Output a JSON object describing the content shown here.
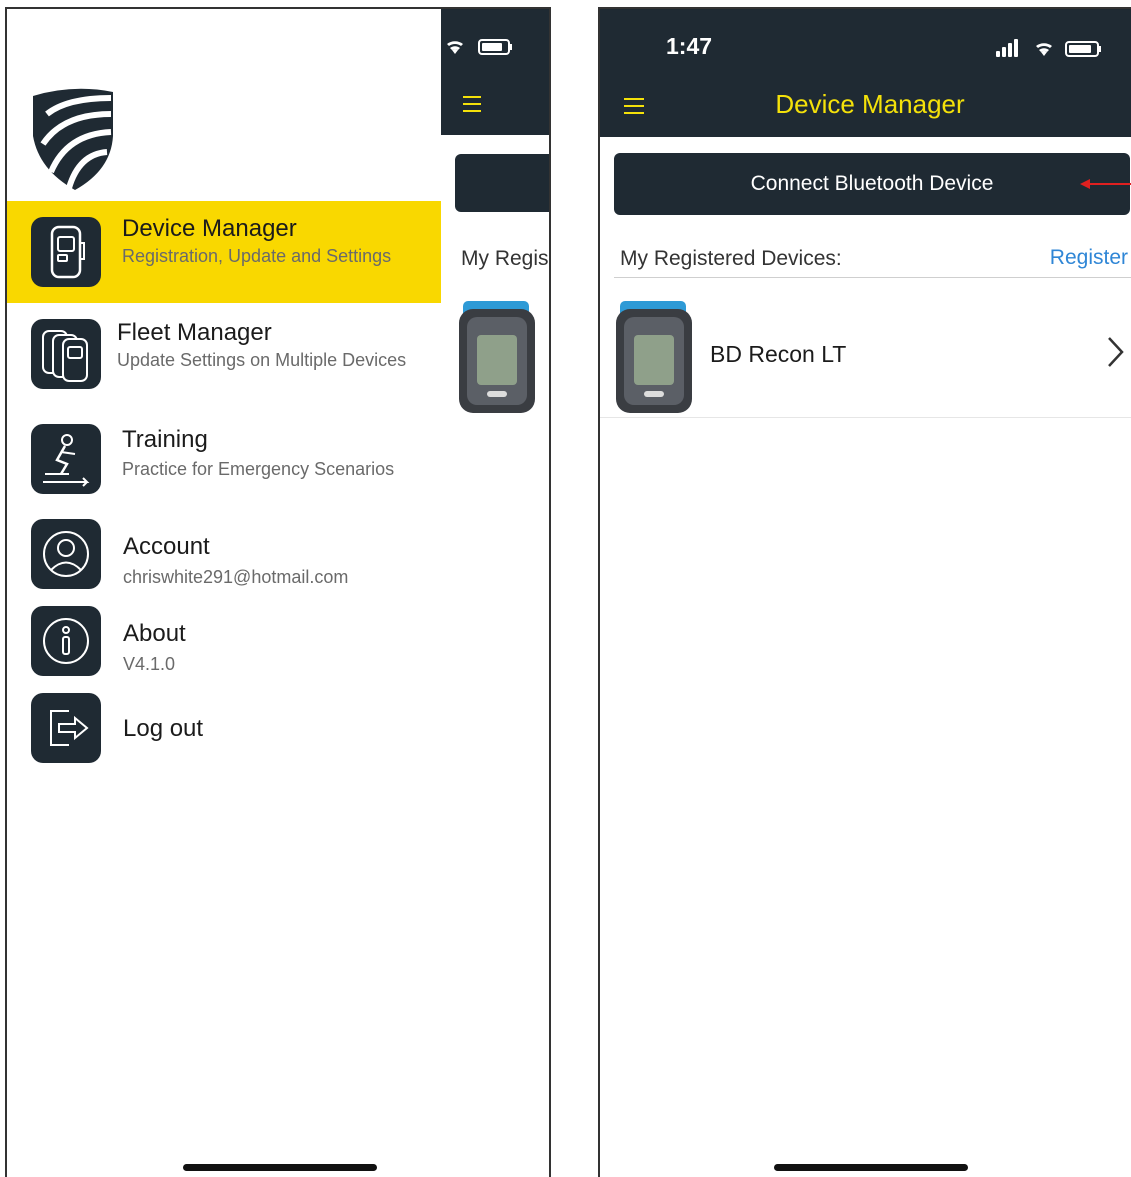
{
  "left_screen": {
    "underlay": {
      "section_label_partial": "My Regis"
    },
    "menu": [
      {
        "title": "Device Manager",
        "subtitle": "Registration, Update and Settings",
        "active": true,
        "icon": "device-icon"
      },
      {
        "title": "Fleet Manager",
        "subtitle": "Update Settings on Multiple Devices",
        "active": false,
        "icon": "fleet-devices-icon"
      },
      {
        "title": "Training",
        "subtitle": "Practice for Emergency Scenarios",
        "active": false,
        "icon": "training-icon"
      },
      {
        "title": "Account",
        "subtitle": "chriswhite291@hotmail.com",
        "active": false,
        "icon": "account-icon"
      },
      {
        "title": "About",
        "subtitle": "V4.1.0",
        "active": false,
        "icon": "info-icon"
      },
      {
        "title": "Log out",
        "subtitle": "",
        "active": false,
        "icon": "logout-icon"
      }
    ]
  },
  "right_screen": {
    "status_time": "1:47",
    "header_title": "Device Manager",
    "connect_button": "Connect Bluetooth Device",
    "section_label": "My Registered Devices:",
    "register_link": "Register",
    "devices": [
      {
        "name": "BD Recon LT"
      }
    ]
  },
  "colors": {
    "dark_bar": "#1f2a33",
    "accent_yellow": "#f9d800",
    "title_yellow": "#f4e10a",
    "link_blue": "#2f86d6",
    "annotation_arrow": "#e02020"
  }
}
